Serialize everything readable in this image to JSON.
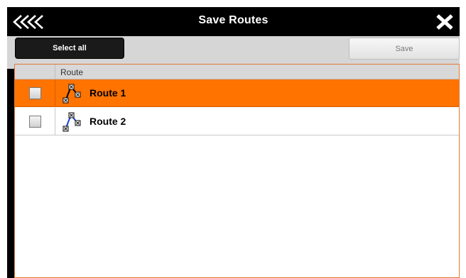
{
  "window": {
    "title": "Save Routes"
  },
  "toolbar": {
    "select_all_label": "Select all",
    "save_label": "Save"
  },
  "table": {
    "column_header": "Route",
    "rows": [
      {
        "label": "Route 1",
        "selected": true,
        "checked": false
      },
      {
        "label": "Route 2",
        "selected": false,
        "checked": false
      }
    ]
  },
  "colors": {
    "titlebar": "#000000",
    "toolbar": "#d6d6d6",
    "selected_row": "#ff7300",
    "table_border": "#e07a3a"
  },
  "icons": {
    "back": "triple-chevron-left-icon",
    "close": "close-x-icon",
    "route": "route-waypoints-icon"
  }
}
